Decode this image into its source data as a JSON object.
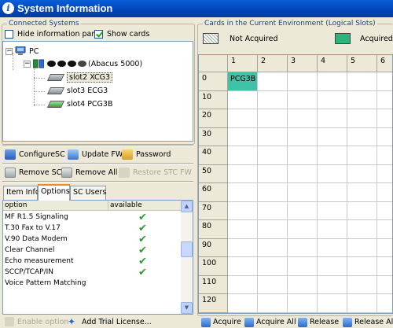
{
  "window": {
    "title": "System Information"
  },
  "connected_systems": {
    "title": "Connected Systems",
    "hide_info_pane": {
      "label": "Hide information pane",
      "checked": false
    },
    "show_cards": {
      "label": "Show cards",
      "checked": true
    },
    "tree": {
      "root": "PC",
      "system_suffix": "(Abacus 5000)",
      "slots": [
        "slot2 XCG3",
        "slot3 ECG3",
        "slot4 PCG3B"
      ]
    }
  },
  "actions": {
    "configure_sc": "ConfigureSC",
    "update_fw": "Update FW",
    "password": "Password",
    "remove_sc": "Remove SC",
    "remove_all": "Remove All",
    "restore_stc_fw": "Restore STC FW"
  },
  "tabs": [
    "Item Info",
    "Options",
    "SC Users"
  ],
  "active_tab": "Options",
  "options_table": {
    "columns": [
      "option",
      "available"
    ],
    "rows": [
      {
        "option": "MF R1.5 Signaling",
        "available": true
      },
      {
        "option": "T.30 Fax to V.17",
        "available": true
      },
      {
        "option": "V.90 Data Modem",
        "available": true
      },
      {
        "option": "Clear Channel",
        "available": true
      },
      {
        "option": "Echo measurement",
        "available": true
      },
      {
        "option": "SCCP/TCAP/IN",
        "available": true
      },
      {
        "option": "Voice Pattern Matching",
        "available": false
      }
    ]
  },
  "option_buttons": {
    "enable_option": "Enable option",
    "add_trial_license": "Add Trial License..."
  },
  "cards_env": {
    "title": "Cards in the Current Environment (Logical Slots)",
    "legend_not_acquired": "Not Acquired",
    "legend_acquired": "Acquired",
    "colors": {
      "acquired": "#3fc2a6",
      "not_acquired_hatch": "#9ab59a"
    },
    "columns": [
      "1",
      "2",
      "3",
      "4",
      "5",
      "6"
    ],
    "rows": [
      "0",
      "10",
      "20",
      "30",
      "40",
      "50",
      "60",
      "70",
      "80",
      "90",
      "100",
      "110",
      "120"
    ],
    "acquired_cell": {
      "row": "0",
      "column": "1",
      "label": "PCG3B"
    }
  },
  "bottom_buttons": {
    "acquire": "Acquire",
    "acquire_all": "Acquire All",
    "release": "Release",
    "release_all": "Release All"
  }
}
